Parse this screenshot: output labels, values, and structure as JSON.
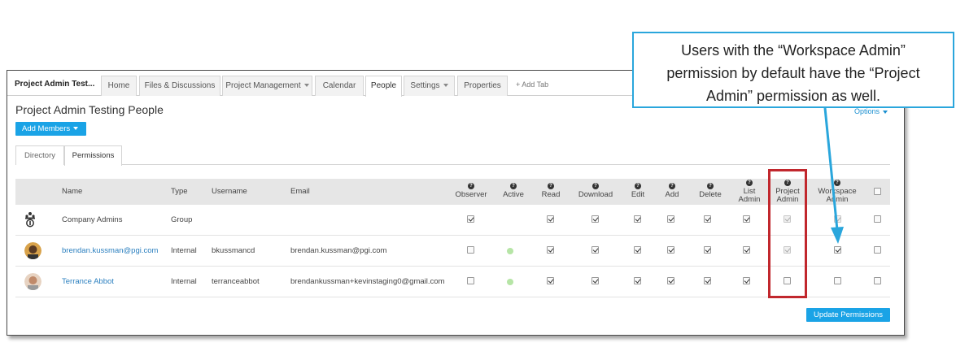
{
  "workspace": {
    "title": "Project Admin Test..."
  },
  "tabs": [
    {
      "label": "Home"
    },
    {
      "label": "Files & Discussions"
    },
    {
      "label": "Project Management"
    },
    {
      "label": "Calendar"
    },
    {
      "label": "People"
    },
    {
      "label": "Settings"
    },
    {
      "label": "Properties"
    }
  ],
  "add_tab": "+ Add Tab",
  "page_title": "Project Admin Testing People",
  "add_members_label": "Add Members",
  "options_label": "Options",
  "subtabs": [
    {
      "label": "Directory"
    },
    {
      "label": "Permissions"
    }
  ],
  "columns": {
    "name": "Name",
    "type": "Type",
    "username": "Username",
    "email": "Email",
    "observer": "Observer",
    "active": "Active",
    "read": "Read",
    "download": "Download",
    "edit": "Edit",
    "add": "Add",
    "delete": "Delete",
    "list_admin": "List Admin",
    "project_admin": "Project Admin",
    "workspace_admin": "Workspace Admin"
  },
  "rows": [
    {
      "name": "Company Admins",
      "type": "Group",
      "username": "",
      "email": ""
    },
    {
      "name": "brendan.kussman@pgi.com",
      "type": "Internal",
      "username": "bkussmancd",
      "email": "brendan.kussman@pgi.com"
    },
    {
      "name": "Terrance Abbot",
      "type": "Internal",
      "username": "terranceabbot",
      "email": "brendankussman+kevinstaging0@gmail.com"
    }
  ],
  "update_button": "Update Permissions",
  "callout": {
    "line1": "Users with the “Workspace Admin”",
    "line2": "permission by default have the “Project",
    "line3": "Admin” permission as well."
  },
  "colors": {
    "accent": "#1aa3e6",
    "highlight": "#c1272d",
    "callout_border": "#2aa6dc"
  }
}
